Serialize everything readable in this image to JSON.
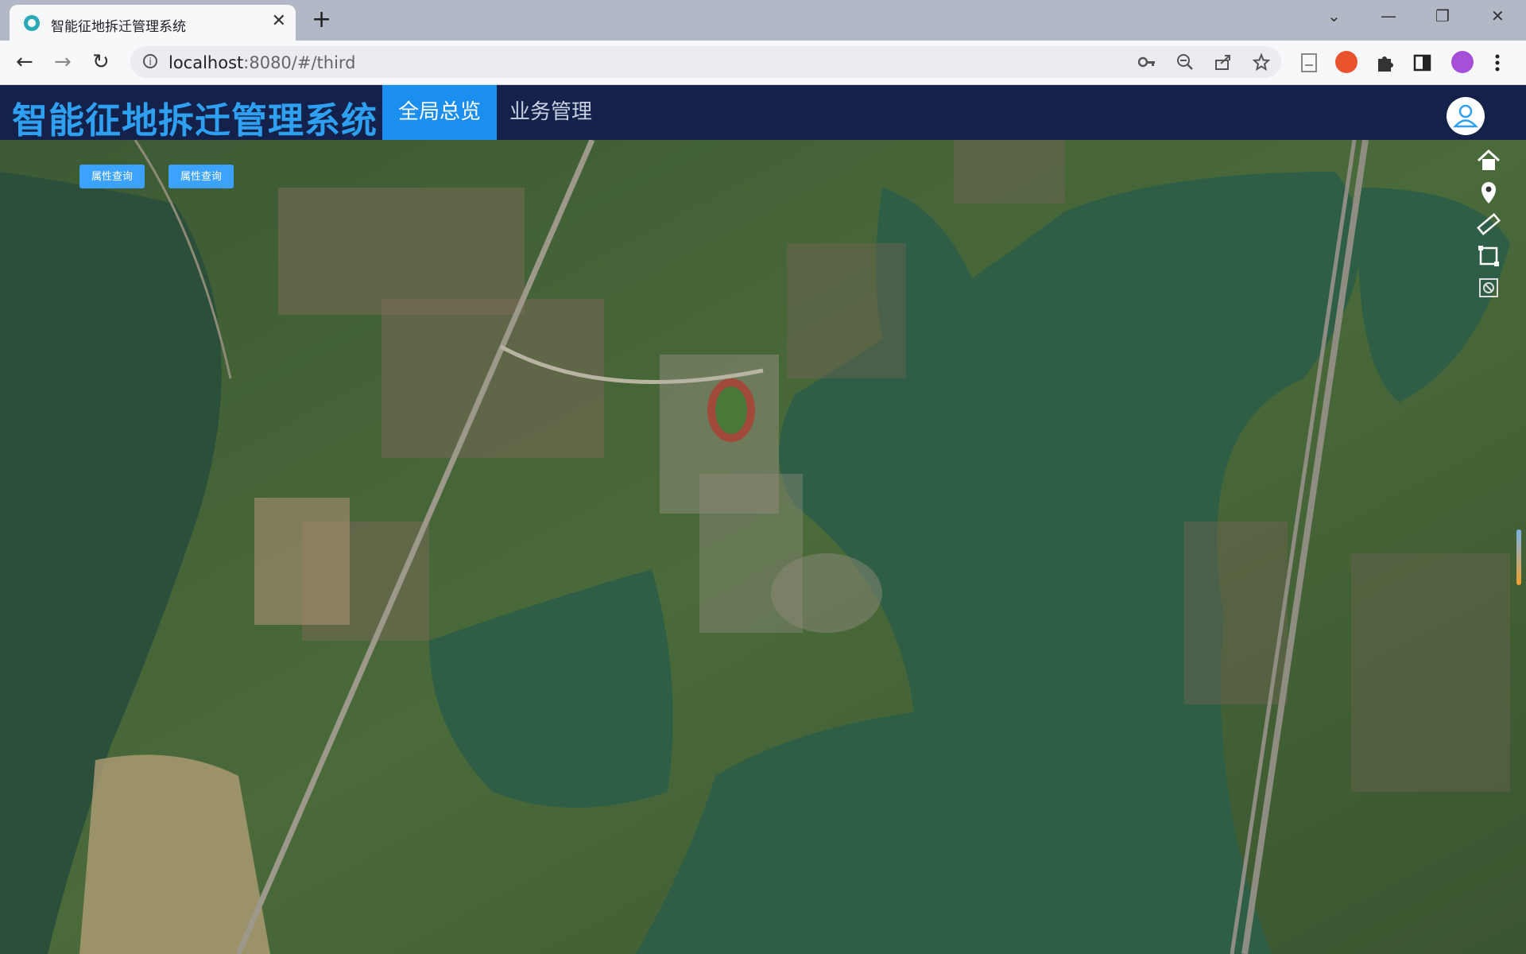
{
  "browser": {
    "tab_title": "智能征地拆迁管理系统",
    "tab_close": "✕",
    "new_tab": "+",
    "url_host": "localhost",
    "url_rest": ":8080/#/third",
    "controls": {
      "collapse": "⌄",
      "minimize": "—",
      "restore": "❐",
      "close": "✕"
    },
    "nav": {
      "back": "←",
      "forward": "→",
      "reload": "↻"
    }
  },
  "app": {
    "title": "智能征地拆迁管理系统",
    "nav": [
      {
        "label": "全局总览",
        "active": true
      },
      {
        "label": "业务管理",
        "active": false
      }
    ]
  },
  "map": {
    "query_buttons": [
      "属性查询",
      "属性查询"
    ],
    "tools": [
      "home-icon",
      "location-pin-icon",
      "ruler-icon",
      "rectangle-draw-icon",
      "clear-icon"
    ]
  },
  "colors": {
    "header_bg": "#13214b",
    "title": "#2fa0f0",
    "active_nav": "#1a8ff0",
    "query_button": "#3ba2ff",
    "lake": "#2f5e46"
  }
}
